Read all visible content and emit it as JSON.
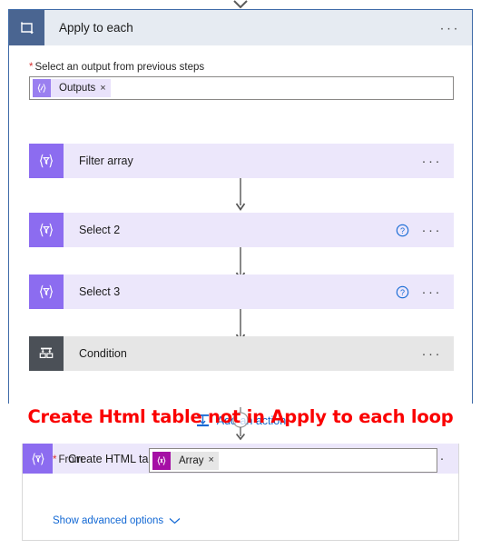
{
  "loop": {
    "title": "Apply to each",
    "icon": "loop-icon",
    "menu": "···",
    "field_label": "Select an output from previous steps",
    "required_marker": "*",
    "token": {
      "label": "Outputs",
      "icon": "expression-braces-icon",
      "remove": "×"
    },
    "actions": [
      {
        "title": "Filter array",
        "icon": "filter-array-icon",
        "style": "purple",
        "has_help": false,
        "menu": "···"
      },
      {
        "title": "Select 2",
        "icon": "select-icon",
        "style": "purple",
        "has_help": true,
        "menu": "···"
      },
      {
        "title": "Select 3",
        "icon": "select-icon",
        "style": "purple",
        "has_help": true,
        "menu": "···"
      },
      {
        "title": "Condition",
        "icon": "condition-branch-icon",
        "style": "gray",
        "has_help": false,
        "menu": "···"
      }
    ],
    "add_action": {
      "label": "Add an action",
      "icon": "insert-action-icon"
    }
  },
  "annotation": {
    "text": "Create Html table not in Apply to each loop",
    "color": "#fa0000"
  },
  "bottom_card": {
    "title": "Create HTML table",
    "icon": "create-html-table-icon",
    "help": "?",
    "menu": "···",
    "from_label": "From",
    "required_marker": "*",
    "token": {
      "label": "Array",
      "icon": "variable-braces-icon",
      "remove": "×"
    },
    "advanced": {
      "label": "Show advanced options",
      "icon": "chevron-down-icon"
    }
  },
  "theme": {
    "loop_header_bg": "#e6ebf2",
    "loop_icon_bg": "#4a6591",
    "loop_border": "#3f6ba8",
    "action_purple_bg": "#ece7fb",
    "action_icon_purple": "#8c6cf0",
    "action_gray_bg": "#e6e6e6",
    "action_icon_dark": "#4b5057",
    "link_blue": "#0f64c8",
    "token_violet": "#9a7ff0",
    "token_magenta": "#a50fa5",
    "annotation_red": "#fa0000"
  }
}
